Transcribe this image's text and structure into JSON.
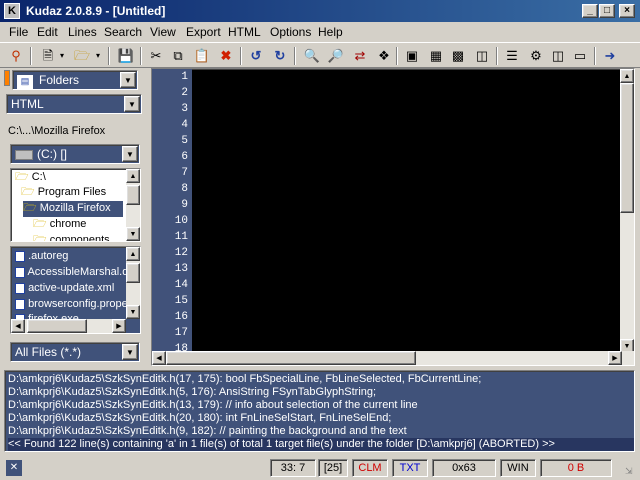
{
  "window": {
    "title": "Kudaz 2.0.8.9 - [Untitled]"
  },
  "menu": [
    "File",
    "Edit",
    "Lines",
    "Search",
    "View",
    "Export",
    "HTML",
    "Options",
    "Help"
  ],
  "toolbar_icons": [
    "search-icon",
    "new-file-icon",
    "open-folder-icon",
    "save-icon",
    "cut-icon",
    "copy-icon",
    "paste-icon",
    "delete-icon",
    "undo-icon",
    "redo-icon",
    "find-icon",
    "find-next-icon",
    "replace-icon",
    "bookmark-icon",
    "browser-icon",
    "page-icon",
    "table-icon",
    "window-icon",
    "properties-icon",
    "settings-icon",
    "exit-icon"
  ],
  "left": {
    "view_combo": "Folders",
    "type_combo": "HTML",
    "path": "C:\\...\\Mozilla Firefox",
    "drive_combo": "(C:) []",
    "folders": [
      "C:\\",
      "Program Files",
      "Mozilla Firefox",
      "chrome",
      "components"
    ],
    "selected_folder_index": 2,
    "files": [
      ".autoreg",
      "AccessibleMarshal.dll",
      "active-update.xml",
      "browserconfig.properties",
      "firefox.exe"
    ],
    "filter_combo": "All Files (*.*)"
  },
  "editor": {
    "line_numbers": [
      "1",
      "2",
      "3",
      "4",
      "5",
      "6",
      "7",
      "8",
      "9",
      "10",
      "11",
      "12",
      "13",
      "14",
      "15",
      "16",
      "17",
      "18"
    ]
  },
  "output": {
    "lines": [
      "D:\\amkprj6\\Kudaz5\\SzkSynEditk.h(17, 175):      bool FbSpecialLine, FbLineSelected, FbCurrentLine;",
      "D:\\amkprj6\\Kudaz5\\SzkSynEditk.h(5, 176):      AnsiString FSynTabGlyphString;",
      "D:\\amkprj6\\Kudaz5\\SzkSynEditk.h(13, 179):      // info about selection of the current line",
      "D:\\amkprj6\\Kudaz5\\SzkSynEditk.h(20, 180):      int FnLineSelStart, FnLineSelEnd;",
      "D:\\amkprj6\\Kudaz5\\SzkSynEditk.h(9, 182):      // painting the background and the text",
      "<<  Found 122 line(s) containing 'a' in 1 file(s) of total 1 target file(s) under the folder [D:\\amkprj6] (ABORTED)  >>"
    ]
  },
  "status": {
    "position": "33: 7",
    "count": "[25]",
    "clm": "CLM",
    "txt": "TXT",
    "hex": "0x63",
    "eol": "WIN",
    "size": "0 B"
  }
}
